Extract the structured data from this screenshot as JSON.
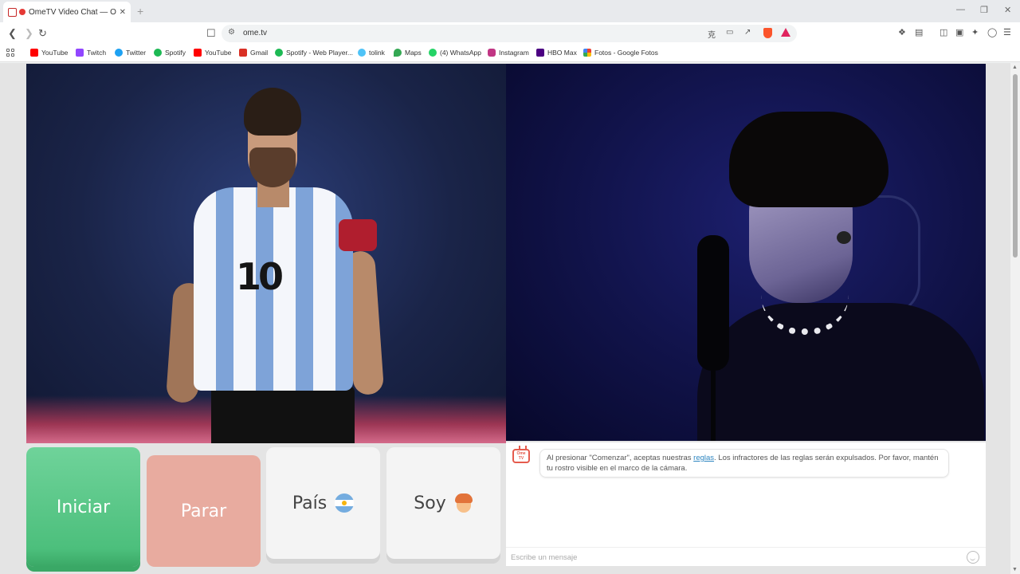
{
  "browser": {
    "tab_title": "OmeTV Video Chat — Omegle",
    "tab_close": "✕",
    "new_tab": "+",
    "url": "ome.tv",
    "window_controls": [
      "—",
      "❐",
      "✕"
    ]
  },
  "bookmarks": [
    {
      "label": "YouTube",
      "icon": "youtube-icon",
      "color": "#ff0000"
    },
    {
      "label": "Twitch",
      "icon": "twitch-icon",
      "color": "#9146ff"
    },
    {
      "label": "Twitter",
      "icon": "twitter-icon",
      "color": "#1da1f2"
    },
    {
      "label": "Spotify",
      "icon": "spotify-icon",
      "color": "#1db954"
    },
    {
      "label": "YouTube",
      "icon": "youtube-icon",
      "color": "#ff0000"
    },
    {
      "label": "Gmail",
      "icon": "gmail-icon",
      "color": "#d93025"
    },
    {
      "label": "Spotify - Web Player...",
      "icon": "spotify-icon",
      "color": "#1db954"
    },
    {
      "label": "tolink",
      "icon": "link-icon",
      "color": "#4fc3f7"
    },
    {
      "label": "Maps",
      "icon": "maps-icon",
      "color": "#34a853"
    },
    {
      "label": "(4) WhatsApp",
      "icon": "whatsapp-icon",
      "color": "#25d366"
    },
    {
      "label": "Instagram",
      "icon": "instagram-icon",
      "color": "#c13584"
    },
    {
      "label": "HBO Max",
      "icon": "hbomax-icon",
      "color": "#4b0082"
    },
    {
      "label": "Fotos - Google Fotos",
      "icon": "google-photos-icon",
      "color": "#fbbc04"
    }
  ],
  "controls": {
    "start_label": "Iniciar",
    "stop_label": "Parar",
    "country_label": "País",
    "gender_label": "Soy"
  },
  "chat": {
    "logo_text": "Ome TV",
    "notice_before": "Al presionar \"Comenzar\", aceptas nuestras ",
    "notice_link": "reglas",
    "notice_after": ". Los infractores de las reglas serán expulsados. Por favor, mantén tu rostro visible en el marco de la cámara.",
    "input_placeholder": "Escribe un mensaje"
  },
  "video": {
    "jersey_number": "10"
  },
  "colors": {
    "start": "#4cbf7c",
    "stop": "#e8ab9f",
    "link": "#2e86c1",
    "brand": "#e55b4d"
  }
}
